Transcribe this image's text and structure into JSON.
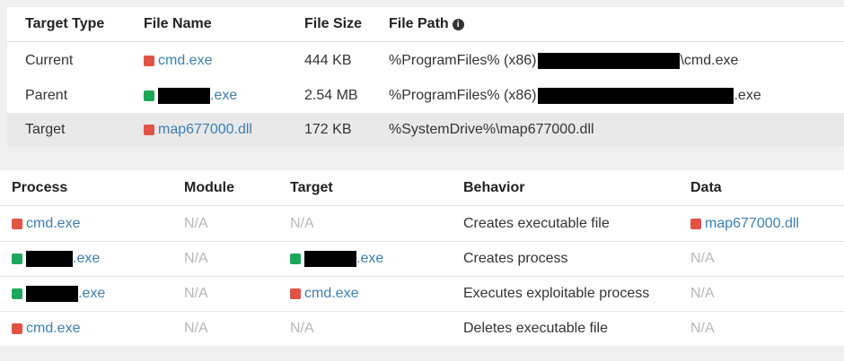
{
  "files": {
    "headers": {
      "target_type": "Target Type",
      "file_name": "File Name",
      "file_size": "File Size",
      "file_path": "File Path"
    },
    "rows": [
      {
        "target_type": "Current",
        "status": "red",
        "file_name": "cmd.exe",
        "file_size": "444 KB",
        "path_prefix": "%ProgramFiles% (x86)",
        "path_suffix": "\\cmd.exe"
      },
      {
        "target_type": "Parent",
        "status": "green",
        "file_name": ".exe",
        "file_size": "2.54 MB",
        "path_prefix": "%ProgramFiles% (x86)",
        "path_suffix": ".exe"
      },
      {
        "target_type": "Target",
        "status": "red",
        "file_name": "map677000.dll",
        "file_size": "172 KB",
        "path_prefix": "%SystemDrive%\\map677000.dll",
        "path_suffix": ""
      }
    ]
  },
  "behaviors": {
    "headers": {
      "process": "Process",
      "module": "Module",
      "target": "Target",
      "behavior": "Behavior",
      "data": "Data"
    },
    "rows": [
      {
        "process": "cmd.exe",
        "process_status": "red",
        "module": "N/A",
        "target": "N/A",
        "behavior": "Creates executable file",
        "data": "map677000.dll"
      },
      {
        "process": ".exe",
        "process_status": "green",
        "module": "N/A",
        "target": ".exe",
        "target_status": "green",
        "behavior": "Creates process",
        "data": "N/A"
      },
      {
        "process": ".exe",
        "process_status": "green",
        "module": "N/A",
        "target": "cmd.exe",
        "target_status": "red",
        "behavior": "Executes exploitable process",
        "data": "N/A"
      },
      {
        "process": "cmd.exe",
        "process_status": "red",
        "module": "N/A",
        "target": "N/A",
        "behavior": "Deletes executable file",
        "data": "N/A"
      }
    ]
  },
  "colors": {
    "status_red": "#e05446",
    "status_green": "#1ea65a",
    "link": "#3d7fb0",
    "na_text": "#b7b7b7"
  },
  "icons": {
    "file_path_info": "info-circle-icon"
  }
}
